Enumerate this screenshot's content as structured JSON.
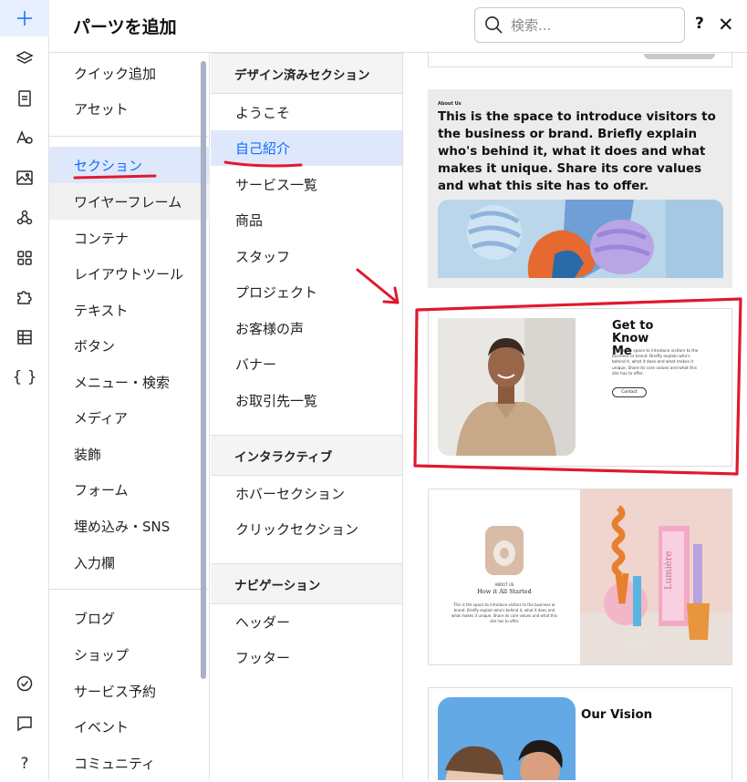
{
  "header": {
    "title": "パーツを追加",
    "search_placeholder": "検索...",
    "help": "?",
    "close": "✕"
  },
  "rail": {
    "add": "+",
    "code": "{ }",
    "help": "?"
  },
  "categories": {
    "group1": [
      "クイック追加",
      "アセット"
    ],
    "group2": [
      "セクション",
      "ワイヤーフレーム",
      "コンテナ",
      "レイアウトツール",
      "テキスト",
      "ボタン",
      "メニュー・検索",
      "メディア",
      "装飾",
      "フォーム",
      "埋め込み・SNS",
      "入力欄"
    ],
    "group3": [
      "ブログ",
      "ショップ",
      "サービス予約",
      "イベント",
      "コミュニティ"
    ]
  },
  "sub": {
    "designed_header": "デザイン済みセクション",
    "designed_items": [
      "ようこそ",
      "自己紹介",
      "サービス一覧",
      "商品",
      "スタッフ",
      "プロジェクト",
      "お客様の声",
      "バナー",
      "お取引先一覧"
    ],
    "interactive_header": "インタラクティブ",
    "interactive_items": [
      "ホバーセクション",
      "クリックセクション"
    ],
    "navigation_header": "ナビゲーション",
    "navigation_items": [
      "ヘッダー",
      "フッター"
    ]
  },
  "cards": {
    "about1": {
      "kicker": "About Us",
      "body": "This is the space to introduce visitors to the business or brand. Briefly explain who's behind it, what it does and what makes it unique. Share its core values and what this site has to offer."
    },
    "about2": {
      "heading": "Get to Know Me",
      "body": "This is the space to introduce visitors to the business or brand. Briefly explain who's behind it, what it does and what makes it unique. Share its core values and what this site has to offer.",
      "button": "Contact"
    },
    "about3": {
      "kicker": "ABOUT US",
      "heading": "How it All Started",
      "body": "This is the space to introduce visitors to the business or brand. Briefly explain who's behind it, what it does and what makes it unique. Share its core values and what this site has to offer.",
      "product": "Lumière"
    },
    "vision": {
      "heading": "Our Vision"
    }
  },
  "colors": {
    "accent": "#116dff",
    "selected_bg": "#dfe8fb",
    "annotation": "#e0192e"
  }
}
